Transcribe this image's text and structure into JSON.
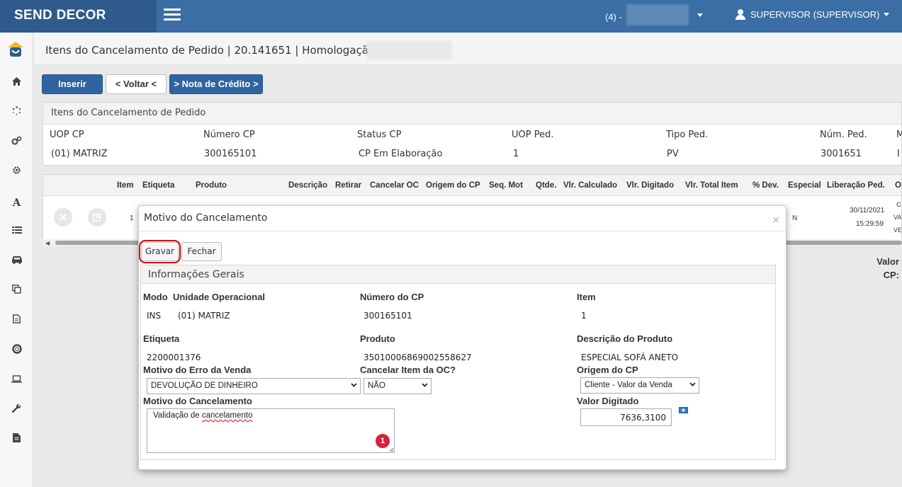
{
  "topbar": {
    "brand": "SEND DECOR",
    "company": "(4) -",
    "user": "SUPERVISOR (SUPERVISOR)"
  },
  "sidebar": {
    "icons": [
      "logo-icon",
      "home-icon",
      "spinner-icon",
      "cogs-icon",
      "gear-icon",
      "font-icon",
      "list-icon",
      "car-icon",
      "copy-icon",
      "document-icon",
      "lifebuoy-icon",
      "laptop-icon",
      "wrench-icon",
      "file-icon"
    ]
  },
  "page": {
    "title": "Itens do Cancelamento de Pedido | 20.141651 | Homologação |"
  },
  "toolbar": {
    "insert": "Inserir",
    "back": "< Voltar <",
    "credit_note": "> Nota de Crédito >"
  },
  "summary": {
    "heading": "Itens do Cancelamento de Pedido",
    "headers": [
      "UOP CP",
      "Número CP",
      "Status CP",
      "UOP Ped.",
      "Tipo Ped.",
      "Núm. Ped.",
      "M"
    ],
    "values": [
      "(01) MATRIZ",
      "300165101",
      "CP Em Elaboração",
      "1",
      "PV",
      "3001651",
      "I"
    ]
  },
  "grid": {
    "headers": [
      "Item",
      "Etiqueta",
      "Produto",
      "Descrição",
      "Retirar",
      "Cancelar OC",
      "Origem do CP",
      "Seq. Mot",
      "Qtde.",
      "Vlr. Calculado",
      "Vlr. Digitado",
      "Vlr. Total Item",
      "% Dev.",
      "Especial",
      "Liberação Ped.",
      "Or"
    ],
    "row": {
      "item": "1",
      "especial": "N",
      "liberacao_date": "30/11/2021",
      "liberacao_time": "15:29:59",
      "origin_lines": [
        "C",
        "VAL",
        "VEN"
      ]
    }
  },
  "side_values": {
    "line1": "Valor",
    "line2": "CP:"
  },
  "modal": {
    "title": "Motivo do Cancelamento",
    "close": "×",
    "save": "Gravar",
    "close_btn": "Fechar",
    "section": "Informações Gerais",
    "fields": {
      "modo_label": "Modo",
      "modo_value": "INS",
      "unidade_label": "Unidade Operacional",
      "unidade_value": "(01) MATRIZ",
      "numero_cp_label": "Número do CP",
      "numero_cp_value": "300165101",
      "item_label": "Item",
      "item_value": "1",
      "etiqueta_label": "Etiqueta",
      "etiqueta_value": "2200001376",
      "produto_label": "Produto",
      "produto_value": "35010006869002558627",
      "descricao_label": "Descrição do Produto",
      "descricao_value": "ESPECIAL SOFÁ ANETO",
      "motivo_erro_label": "Motivo do Erro da Venda",
      "motivo_erro_value": "DEVOLUÇÃO DE DINHEIRO",
      "cancelar_oc_label": "Cancelar Item da OC?",
      "cancelar_oc_value": "NÃO",
      "origem_label": "Origem do CP",
      "origem_value": "Cliente - Valor da Venda",
      "motivo_cancel_label": "Motivo do Cancelamento",
      "motivo_cancel_prefix": "Validação de ",
      "motivo_cancel_misspelled": "cancelamento",
      "valor_label": "Valor Digitado",
      "valor_value": "7636,3100"
    },
    "badge": "1"
  },
  "colors": {
    "topbar": "#3a6ea5",
    "brand_bg": "#2e5b8b",
    "primary_button": "#2f64a0",
    "highlight": "#e00000",
    "badge": "#d9213c"
  }
}
